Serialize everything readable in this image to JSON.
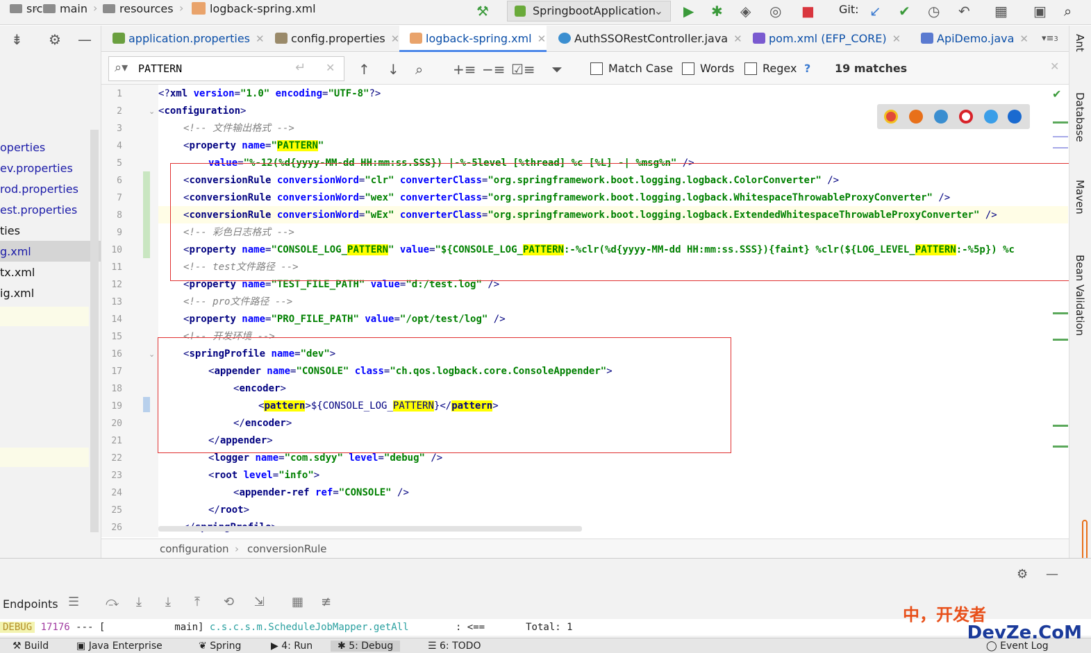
{
  "breadcrumb": [
    "src",
    "main",
    "resources",
    "logback-spring.xml"
  ],
  "run_config": "SpringbootApplication",
  "git_label": "Git:",
  "project_files": [
    "operties",
    "ev.properties",
    "rod.properties",
    "est.properties",
    "ties",
    "g.xml",
    "tx.xml",
    "ig.xml"
  ],
  "tabs": [
    {
      "label": "application.properties",
      "color": "#6a9f3f"
    },
    {
      "label": "config.properties",
      "color": "#9a8a6a"
    },
    {
      "label": "logback-spring.xml",
      "color": "#e9a36b"
    },
    {
      "label": "AuthSSORestController.java",
      "color": "#3a8ed0"
    },
    {
      "label": "pom.xml (EFP_CORE)",
      "color": "#7a5ad0"
    },
    {
      "label": "ApiDemo.java",
      "color": "#5a7ad0"
    }
  ],
  "tab_overflow": "3",
  "find": {
    "query": "PATTERN",
    "match_case": "Match Case",
    "words": "Words",
    "regex": "Regex",
    "help": "?",
    "matches": "19 matches"
  },
  "line_numbers": [
    "1",
    "2",
    "3",
    "4",
    "5",
    "6",
    "7",
    "8",
    "9",
    "10",
    "11",
    "12",
    "13",
    "14",
    "15",
    "16",
    "17",
    "18",
    "19",
    "20",
    "21",
    "22",
    "23",
    "24",
    "25",
    "26"
  ],
  "editor_breadcrumb": [
    "configuration",
    "conversionRule"
  ],
  "right_tools": [
    "Ant",
    "Database",
    "Maven",
    "Bean Validation"
  ],
  "bottom": {
    "tool_label": "Endpoints"
  },
  "console": {
    "level": "DEBUG",
    "pid": "17176",
    "sep": " --- [",
    "thread": "main]",
    "logger": "c.s.c.s.m.ScheduleJobMapper.getAll",
    "arrow": ": <==",
    "total": "Total: 1"
  },
  "status": [
    "Build",
    "Java Enterprise",
    "Spring",
    "4: Run",
    "5: Debug",
    "6: TODO",
    "Event Log"
  ],
  "watermark": {
    "line1": "中，开发者",
    "line2": "DevZe.CoM"
  }
}
